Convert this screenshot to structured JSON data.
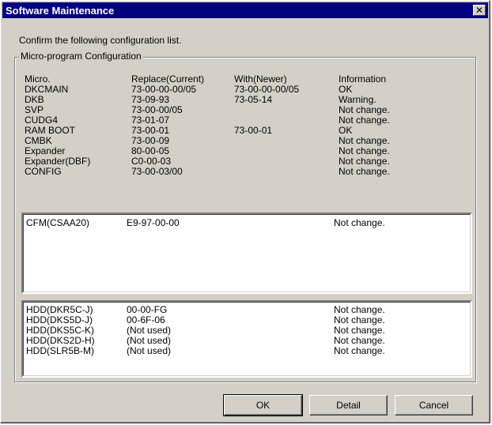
{
  "window": {
    "title": "Software Maintenance",
    "close_glyph": "✕"
  },
  "instruction": "Confirm the following configuration list.",
  "group": {
    "label": "Micro-program Configuration",
    "headers": [
      "Micro.",
      "Replace(Current)",
      "With(Newer)",
      "Information"
    ],
    "rows": [
      [
        "DKCMAIN",
        "73-00-00-00/05",
        "73-00-00-00/05",
        "OK"
      ],
      [
        "DKB",
        "73-09-93",
        "73-05-14",
        "Warning."
      ],
      [
        "SVP",
        "73-00-00/05",
        "",
        "Not change."
      ],
      [
        "CUDG4",
        "73-01-07",
        "",
        "Not change."
      ],
      [
        "RAM BOOT",
        "73-00-01",
        "73-00-01",
        "OK"
      ],
      [
        "CMBK",
        "73-00-09",
        "",
        "Not change."
      ],
      [
        "Expander",
        "80-00-05",
        "",
        "Not change."
      ],
      [
        "Expander(DBF)",
        "C0-00-03",
        "",
        "Not change."
      ],
      [
        "CONFIG",
        "73-00-03/00",
        "",
        "Not change."
      ]
    ]
  },
  "cfm_list": {
    "rows": [
      [
        "CFM(CSAA20)",
        "E9-97-00-00",
        "Not change."
      ]
    ]
  },
  "hdd_list": {
    "rows": [
      [
        "HDD(DKR5C-J)",
        "00-00-FG",
        "Not change."
      ],
      [
        "HDD(DKS5D-J)",
        "00-6F-06",
        "Not change."
      ],
      [
        "HDD(DKS5C-K)",
        "(Not used)",
        "Not change."
      ],
      [
        "HDD(DKS2D-H)",
        "(Not used)",
        "Not change."
      ],
      [
        "HDD(SLR5B-M)",
        "(Not used)",
        "Not change."
      ]
    ]
  },
  "buttons": {
    "ok": "OK",
    "detail": "Detail",
    "cancel": "Cancel"
  }
}
